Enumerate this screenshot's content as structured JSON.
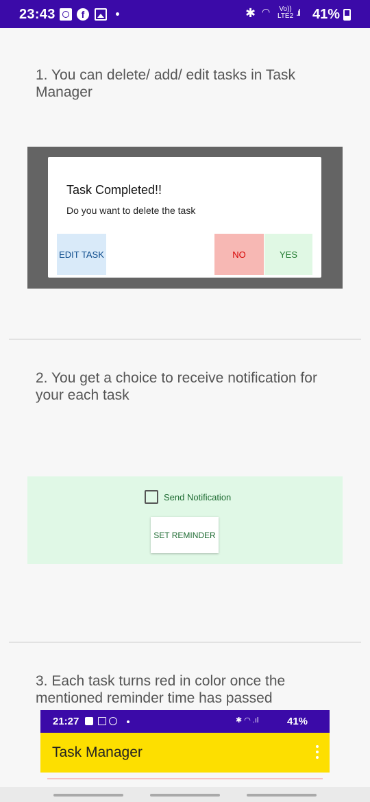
{
  "status_bar": {
    "time": "23:43",
    "battery": "41%",
    "volte": "Vo))\nLTE2",
    "icons": [
      "alarm-icon",
      "facebook-icon",
      "gallery-icon",
      "bluetooth-icon",
      "wifi-icon",
      "signal-icon",
      "battery-icon"
    ]
  },
  "steps": {
    "step1": "1. You can delete/ add/ edit tasks in Task Manager",
    "step2": "2. You get a choice to receive notification for your each task",
    "step3": "3. Each task turns red in color once the mentioned reminder time has passed"
  },
  "dialog": {
    "title": "Task Completed!!",
    "message": "Do you want to delete the task",
    "edit_label": "EDIT TASK",
    "no_label": "NO",
    "yes_label": "YES"
  },
  "notification": {
    "checkbox_label": "Send Notification",
    "checked": false,
    "reminder_label": "SET REMINDER"
  },
  "app_preview": {
    "time": "21:27",
    "battery": "41%",
    "title": "Task Manager"
  },
  "colors": {
    "status_bar": "#3b0aa8",
    "app_bar": "#fddf00",
    "edit_bg": "#d9eaf9",
    "no_bg": "#f7b8b4",
    "yes_bg": "#e0f8e4",
    "notification_bg": "#e0f8e6"
  }
}
